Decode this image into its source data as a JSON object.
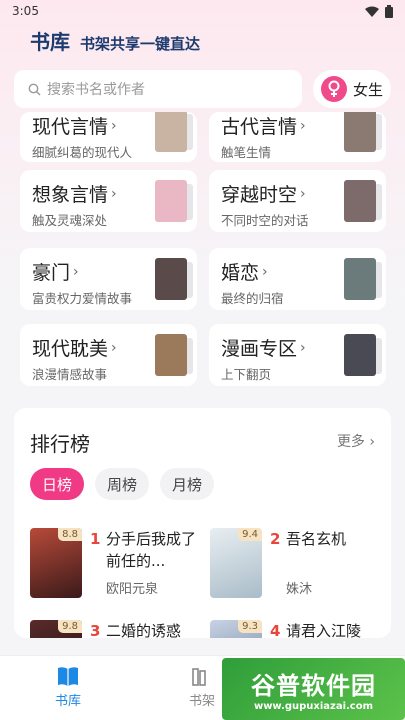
{
  "status": {
    "time": "3:05"
  },
  "header": {
    "title": "书库",
    "slogan": "书架共享一键直达"
  },
  "search": {
    "placeholder": "搜索书名或作者"
  },
  "gender": {
    "label": "女生",
    "color": "#f04a8a"
  },
  "categories": [
    {
      "name": "现代言情",
      "desc": "细腻纠葛的现代人",
      "cover": "#c9b3a3"
    },
    {
      "name": "古代言情",
      "desc": "触笔生情",
      "cover": "#8a7a72"
    },
    {
      "name": "想象言情",
      "desc": "触及灵魂深处",
      "cover": "#e9b8c4"
    },
    {
      "name": "穿越时空",
      "desc": "不同时空的对话",
      "cover": "#7d6a6a"
    },
    {
      "name": "豪门",
      "desc": "富贵权力爱情故事",
      "cover": "#5a4a4a"
    },
    {
      "name": "婚恋",
      "desc": "最终的归宿",
      "cover": "#6b7a7a"
    },
    {
      "name": "现代耽美",
      "desc": "浪漫情感故事",
      "cover": "#9a7a5a"
    },
    {
      "name": "漫画专区",
      "desc": "上下翻页",
      "cover": "#4a4a55"
    }
  ],
  "ranking": {
    "title": "排行榜",
    "more": "更多",
    "tabs": [
      "日榜",
      "周榜",
      "月榜"
    ],
    "books": [
      {
        "rank": "1",
        "title": "分手后我成了前任的...",
        "author": "欧阳元泉",
        "score": "8.8",
        "cover": "#7a2a2a"
      },
      {
        "rank": "2",
        "title": "吾名玄机",
        "author": "姝沐",
        "score": "9.4",
        "cover": "#cfd8dc"
      },
      {
        "rank": "3",
        "title": "二婚的诱惑",
        "author": "",
        "score": "9.8",
        "cover": "#3a2a2a"
      },
      {
        "rank": "4",
        "title": "请君入江陵",
        "author": "",
        "score": "9.3",
        "cover": "#8a9ab0"
      }
    ]
  },
  "nav": {
    "library": "书库",
    "shelf": "书架",
    "accent": "#1e88e5"
  },
  "watermark": {
    "main": "谷普软件园",
    "sub": "www.gupuxiazai.com"
  }
}
